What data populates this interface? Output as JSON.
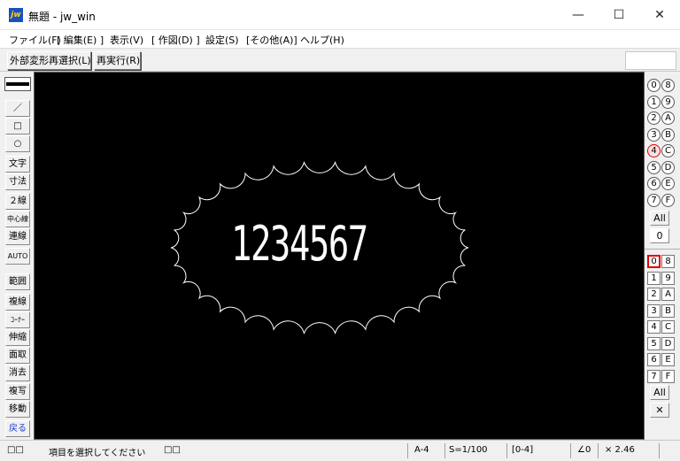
{
  "window": {
    "app_icon": "jw",
    "title": "無題 - jw_win",
    "controls": [
      "—",
      "☐",
      "✕"
    ]
  },
  "menu": [
    "ファイル(F)",
    "[ 編集(E) ]",
    "表示(V)",
    "[ 作図(D) ]",
    "設定(S)",
    "[その他(A)]",
    "ヘルプ(H)"
  ],
  "toolbar": {
    "reselect_label": "外部変形再選択(L)",
    "rerun_label": "再実行(R)"
  },
  "left_tools": [
    "／",
    "□",
    "○",
    "文字",
    "寸法",
    "２線",
    "中心線",
    "連線",
    "AUTO",
    "範囲",
    "複線",
    "ｺｰﾅｰ",
    "伸縮",
    "面取",
    "消去",
    "複写",
    "移動",
    "戻る"
  ],
  "canvas": {
    "text": "1234567",
    "shape": "cloud-outline"
  },
  "layer_groups": {
    "rows": [
      [
        "0",
        "8"
      ],
      [
        "1",
        "9"
      ],
      [
        "2",
        "A"
      ],
      [
        "3",
        "B"
      ],
      [
        "4",
        "C"
      ],
      [
        "5",
        "D"
      ],
      [
        "6",
        "E"
      ],
      [
        "7",
        "F"
      ]
    ],
    "active": "4",
    "all_label": "All",
    "value": "0"
  },
  "layers": {
    "rows": [
      [
        "0",
        "8"
      ],
      [
        "1",
        "9"
      ],
      [
        "2",
        "A"
      ],
      [
        "3",
        "B"
      ],
      [
        "4",
        "C"
      ],
      [
        "5",
        "D"
      ],
      [
        "6",
        "E"
      ],
      [
        "7",
        "F"
      ]
    ],
    "active": "0",
    "all_label": "All",
    "cross_symbol": "✕"
  },
  "status": {
    "left_icon": "□□",
    "message": "項目を選択してください",
    "mid_icon": "□□",
    "paper": "A-4",
    "scale": "S=1/100",
    "layer": "[0-4]",
    "angle": "∠0",
    "zoom": "× 2.46"
  },
  "colors": {
    "canvas_bg": "#000000",
    "drawing": "#ffffff",
    "active_layer": "#e00000",
    "blue_label": "#1a3fd6"
  }
}
